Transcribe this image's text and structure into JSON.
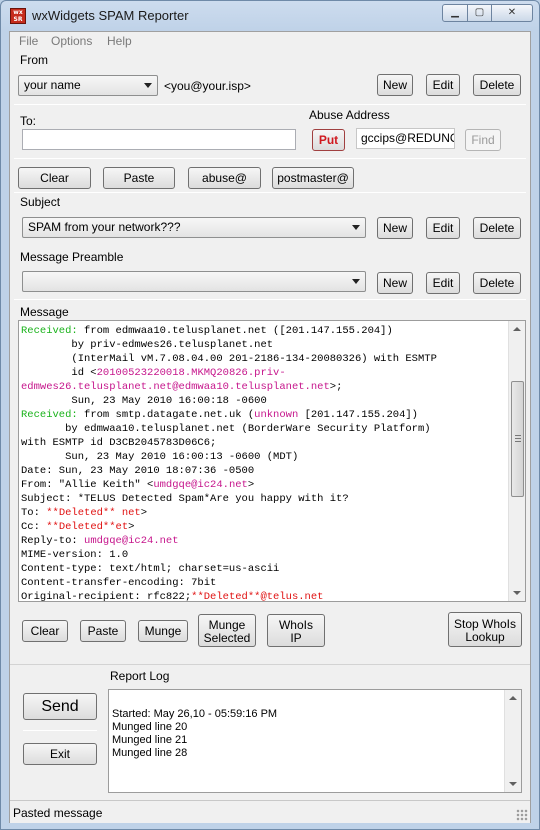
{
  "window": {
    "title": "wxWidgets SPAM Reporter",
    "icon_text": "wx\nSR",
    "controls": {
      "minimize": "▁",
      "maximize": "▢",
      "close": "✕"
    }
  },
  "menu": [
    "File",
    "Options",
    "Help"
  ],
  "from": {
    "label": "From",
    "name_value": "your name",
    "email": "<you@your.isp>",
    "new": "New",
    "edit": "Edit",
    "delete": "Delete"
  },
  "to": {
    "label": "To:",
    "value": ""
  },
  "abuse": {
    "label": "Abuse Address",
    "put": "Put",
    "value": "gccips@REDUNO.C",
    "find": "Find"
  },
  "quick": {
    "clear": "Clear",
    "paste": "Paste",
    "abuse_at": "abuse@",
    "postmaster_at": "postmaster@"
  },
  "subject": {
    "label": "Subject",
    "value": "SPAM from your network???",
    "new": "New",
    "edit": "Edit",
    "delete": "Delete"
  },
  "preamble": {
    "label": "Message Preamble",
    "value": "",
    "new": "New",
    "edit": "Edit",
    "delete": "Delete"
  },
  "message": {
    "label": "Message",
    "lines": [
      [
        [
          "Received:",
          "g"
        ],
        [
          " from edmwaa10.telusplanet.net ([201.147.155.204])",
          ""
        ]
      ],
      [
        [
          "        by priv-edmwes26.telusplanet.net",
          ""
        ]
      ],
      [
        [
          "        (InterMail vM.7.08.04.00 201-2186-134-20080326) with ESMTP",
          ""
        ]
      ],
      [
        [
          "        id <",
          ""
        ],
        [
          "20100523220018.MKMQ20826.priv-",
          "m"
        ]
      ],
      [
        [
          "edmwes26.telusplanet.net@edmwaa10.telusplanet.net",
          "m"
        ],
        [
          ">;",
          ""
        ]
      ],
      [
        [
          "        Sun, 23 May 2010 16:00:18 -0600",
          ""
        ]
      ],
      [
        [
          "Received:",
          "g"
        ],
        [
          " from smtp.datagate.net.uk (",
          ""
        ],
        [
          "unknown",
          "m"
        ],
        [
          " [201.147.155.204])",
          ""
        ]
      ],
      [
        [
          "       by edmwaa10.telusplanet.net (BorderWare Security Platform)",
          ""
        ]
      ],
      [
        [
          "with ESMTP id D3CB2045783D06C6;",
          ""
        ]
      ],
      [
        [
          "       Sun, 23 May 2010 16:00:13 -0600 (MDT)",
          ""
        ]
      ],
      [
        [
          "Date: Sun, 23 May 2010 18:07:36 -0500",
          ""
        ]
      ],
      [
        [
          "From: \"Allie Keith\" <",
          ""
        ],
        [
          "umdgqe@ic24.net",
          "m"
        ],
        [
          ">",
          ""
        ]
      ],
      [
        [
          "Subject: *TELUS Detected Spam*Are you happy with it?",
          ""
        ]
      ],
      [
        [
          "To: ",
          ""
        ],
        [
          "**Deleted** net",
          "r"
        ],
        [
          ">",
          ""
        ]
      ],
      [
        [
          "Cc: ",
          ""
        ],
        [
          "**Deleted**et",
          "r"
        ],
        [
          ">",
          ""
        ]
      ],
      [
        [
          "Reply-to: ",
          ""
        ],
        [
          "umdgqe@ic24.net",
          "m"
        ]
      ],
      [
        [
          "MIME-version: 1.0",
          ""
        ]
      ],
      [
        [
          "Content-type: text/html; charset=us-ascii",
          ""
        ]
      ],
      [
        [
          "Content-transfer-encoding: 7bit",
          ""
        ]
      ],
      [
        [
          "Original-recipient: rfc822;",
          ""
        ],
        [
          "**Deleted**@telus.net",
          "r"
        ]
      ]
    ]
  },
  "message_actions": {
    "clear": "Clear",
    "paste": "Paste",
    "munge": "Munge",
    "munge_selected_1": "Munge",
    "munge_selected_2": "Selected",
    "whois_ip_1": "WhoIs",
    "whois_ip_2": "IP",
    "stop_whois_1": "Stop WhoIs",
    "stop_whois_2": "Lookup"
  },
  "send": "Send",
  "exit": "Exit",
  "report_log": {
    "label": "Report Log",
    "lines": [
      "Started: May 26,10  - 05:59:16 PM",
      "Munged line 20",
      "Munged line 21",
      "Munged line 28"
    ]
  },
  "status": "Pasted message",
  "colors": {
    "header_name": "#19b21a",
    "address": "#c6168c",
    "deleted": "#e01212"
  }
}
